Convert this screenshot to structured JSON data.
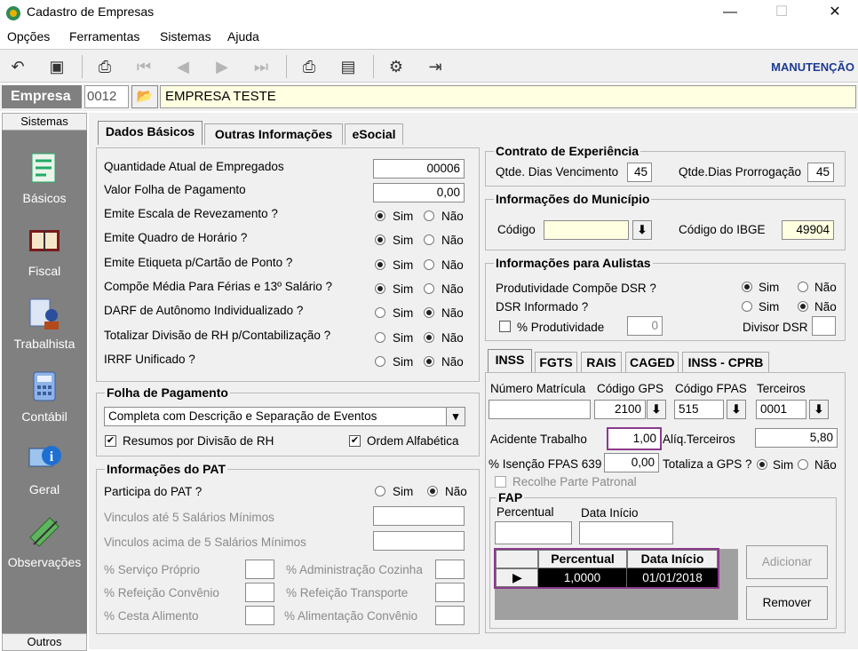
{
  "window": {
    "title": "Cadastro de Empresas",
    "min": "—",
    "max": "☐",
    "close": "✕"
  },
  "menu": [
    "Opções",
    "Ferramentas",
    "Sistemas",
    "Ajuda"
  ],
  "toolbar": {
    "mode": "MANUTENÇÃO"
  },
  "empresa": {
    "label": "Empresa",
    "code": "0012",
    "name": "EMPRESA TESTE"
  },
  "sidebar": {
    "top": "Sistemas",
    "bottom": "Outros",
    "items": [
      "Básicos",
      "Fiscal",
      "Trabalhista",
      "Contábil",
      "Geral",
      "Observações"
    ]
  },
  "tabs": [
    "Dados Básicos",
    "Outras Informações",
    "eSocial"
  ],
  "basic": {
    "qtd_label": "Quantidade Atual de Empregados",
    "qtd_value": "00006",
    "folha_label": "Valor Folha de Pagamento",
    "folha_value": "0,00",
    "yesno": [
      "Sim",
      "Não"
    ],
    "rows": [
      {
        "label": "Emite Escala de Revezamento ?",
        "value": "Sim"
      },
      {
        "label": "Emite Quadro de Horário ?",
        "value": "Sim"
      },
      {
        "label": "Emite Etiqueta p/Cartão de Ponto ?",
        "value": "Sim"
      },
      {
        "label": "Compõe Média Para Férias e 13º Salário ?",
        "value": "Sim"
      },
      {
        "label": "DARF de Autônomo Individualizado ?",
        "value": "Não"
      },
      {
        "label": "Totalizar Divisão de RH p/Contabilização ?",
        "value": "Não"
      },
      {
        "label": "IRRF Unificado ?",
        "value": "Não"
      }
    ]
  },
  "folha": {
    "title": "Folha de Pagamento",
    "select": "Completa com Descrição e Separação de Eventos",
    "chk1": "Resumos por Divisão de RH",
    "chk2": "Ordem Alfabética"
  },
  "pat": {
    "title": "Informações do PAT",
    "participa": "Participa do PAT ?",
    "v1": "Vinculos até 5 Salários Mínimos",
    "v2": "Vinculos acima de 5 Salários Mínimos",
    "p1": "% Serviço Próprio",
    "p2": "% Administração Cozinha",
    "p3": "% Refeição Convênio",
    "p4": "% Refeição Transporte",
    "p5": "% Cesta Alimento",
    "p6": "% Alimentação Convênio"
  },
  "contrato": {
    "title": "Contrato de Experiência",
    "venc_label": "Qtde. Dias Vencimento",
    "venc": "45",
    "prorr_label": "Qtde.Dias Prorrogação",
    "prorr": "45"
  },
  "municipio": {
    "title": "Informações do Município",
    "codigo": "Código",
    "ibge_label": "Código do IBGE",
    "ibge": "49904"
  },
  "aulistas": {
    "title": "Informações para Aulistas",
    "prod": "Produtividade Compõe DSR ?",
    "dsr": "DSR Informado ?",
    "pct": "% Produtividade",
    "pct_val": "0",
    "divisor": "Divisor DSR"
  },
  "subtabs": [
    "INSS",
    "FGTS",
    "RAIS",
    "CAGED",
    "INSS - CPRB"
  ],
  "inss": {
    "matricula": "Número Matrícula",
    "gps": "Código GPS",
    "gps_val": "2100",
    "fpas": "Código FPAS",
    "fpas_val": "515",
    "terceiros": "Terceiros",
    "terceiros_val": "0001",
    "acidente": "Acidente Trabalho",
    "acidente_val": "1,00",
    "aliq": "Alíq.Terceiros",
    "aliq_val": "5,80",
    "isencao": "% Isenção FPAS 639",
    "isencao_val": "0,00",
    "totaliza": "Totaliza a GPS ?",
    "recolhe": "Recolhe Parte Patronal"
  },
  "fap": {
    "title": "FAP",
    "percentual": "Percentual",
    "data": "Data Início",
    "grid_h1": "Percentual",
    "grid_h2": "Data Início",
    "row_pct": "1,0000",
    "row_date": "01/01/2018",
    "add": "Adicionar",
    "remove": "Remover"
  }
}
